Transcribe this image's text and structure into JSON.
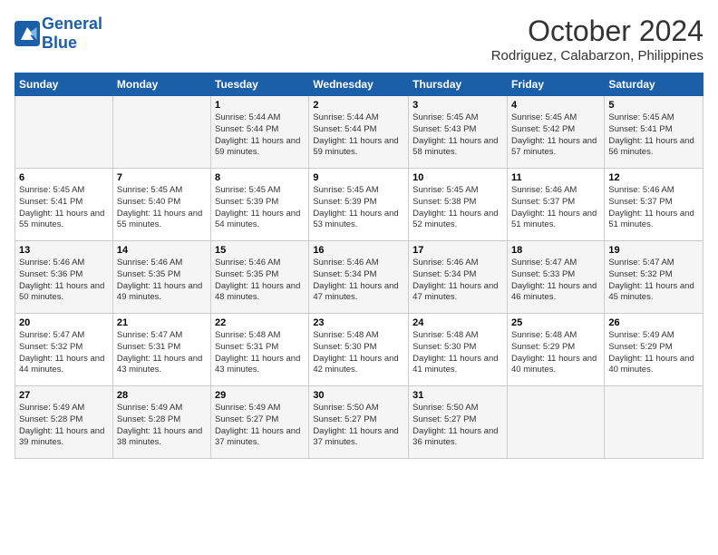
{
  "header": {
    "logo_line1": "General",
    "logo_line2": "Blue",
    "title": "October 2024",
    "subtitle": "Rodriguez, Calabarzon, Philippines"
  },
  "weekdays": [
    "Sunday",
    "Monday",
    "Tuesday",
    "Wednesday",
    "Thursday",
    "Friday",
    "Saturday"
  ],
  "weeks": [
    [
      {
        "day": "",
        "info": ""
      },
      {
        "day": "",
        "info": ""
      },
      {
        "day": "1",
        "info": "Sunrise: 5:44 AM\nSunset: 5:44 PM\nDaylight: 11 hours and 59 minutes."
      },
      {
        "day": "2",
        "info": "Sunrise: 5:44 AM\nSunset: 5:44 PM\nDaylight: 11 hours and 59 minutes."
      },
      {
        "day": "3",
        "info": "Sunrise: 5:45 AM\nSunset: 5:43 PM\nDaylight: 11 hours and 58 minutes."
      },
      {
        "day": "4",
        "info": "Sunrise: 5:45 AM\nSunset: 5:42 PM\nDaylight: 11 hours and 57 minutes."
      },
      {
        "day": "5",
        "info": "Sunrise: 5:45 AM\nSunset: 5:41 PM\nDaylight: 11 hours and 56 minutes."
      }
    ],
    [
      {
        "day": "6",
        "info": "Sunrise: 5:45 AM\nSunset: 5:41 PM\nDaylight: 11 hours and 55 minutes."
      },
      {
        "day": "7",
        "info": "Sunrise: 5:45 AM\nSunset: 5:40 PM\nDaylight: 11 hours and 55 minutes."
      },
      {
        "day": "8",
        "info": "Sunrise: 5:45 AM\nSunset: 5:39 PM\nDaylight: 11 hours and 54 minutes."
      },
      {
        "day": "9",
        "info": "Sunrise: 5:45 AM\nSunset: 5:39 PM\nDaylight: 11 hours and 53 minutes."
      },
      {
        "day": "10",
        "info": "Sunrise: 5:45 AM\nSunset: 5:38 PM\nDaylight: 11 hours and 52 minutes."
      },
      {
        "day": "11",
        "info": "Sunrise: 5:46 AM\nSunset: 5:37 PM\nDaylight: 11 hours and 51 minutes."
      },
      {
        "day": "12",
        "info": "Sunrise: 5:46 AM\nSunset: 5:37 PM\nDaylight: 11 hours and 51 minutes."
      }
    ],
    [
      {
        "day": "13",
        "info": "Sunrise: 5:46 AM\nSunset: 5:36 PM\nDaylight: 11 hours and 50 minutes."
      },
      {
        "day": "14",
        "info": "Sunrise: 5:46 AM\nSunset: 5:35 PM\nDaylight: 11 hours and 49 minutes."
      },
      {
        "day": "15",
        "info": "Sunrise: 5:46 AM\nSunset: 5:35 PM\nDaylight: 11 hours and 48 minutes."
      },
      {
        "day": "16",
        "info": "Sunrise: 5:46 AM\nSunset: 5:34 PM\nDaylight: 11 hours and 47 minutes."
      },
      {
        "day": "17",
        "info": "Sunrise: 5:46 AM\nSunset: 5:34 PM\nDaylight: 11 hours and 47 minutes."
      },
      {
        "day": "18",
        "info": "Sunrise: 5:47 AM\nSunset: 5:33 PM\nDaylight: 11 hours and 46 minutes."
      },
      {
        "day": "19",
        "info": "Sunrise: 5:47 AM\nSunset: 5:32 PM\nDaylight: 11 hours and 45 minutes."
      }
    ],
    [
      {
        "day": "20",
        "info": "Sunrise: 5:47 AM\nSunset: 5:32 PM\nDaylight: 11 hours and 44 minutes."
      },
      {
        "day": "21",
        "info": "Sunrise: 5:47 AM\nSunset: 5:31 PM\nDaylight: 11 hours and 43 minutes."
      },
      {
        "day": "22",
        "info": "Sunrise: 5:48 AM\nSunset: 5:31 PM\nDaylight: 11 hours and 43 minutes."
      },
      {
        "day": "23",
        "info": "Sunrise: 5:48 AM\nSunset: 5:30 PM\nDaylight: 11 hours and 42 minutes."
      },
      {
        "day": "24",
        "info": "Sunrise: 5:48 AM\nSunset: 5:30 PM\nDaylight: 11 hours and 41 minutes."
      },
      {
        "day": "25",
        "info": "Sunrise: 5:48 AM\nSunset: 5:29 PM\nDaylight: 11 hours and 40 minutes."
      },
      {
        "day": "26",
        "info": "Sunrise: 5:49 AM\nSunset: 5:29 PM\nDaylight: 11 hours and 40 minutes."
      }
    ],
    [
      {
        "day": "27",
        "info": "Sunrise: 5:49 AM\nSunset: 5:28 PM\nDaylight: 11 hours and 39 minutes."
      },
      {
        "day": "28",
        "info": "Sunrise: 5:49 AM\nSunset: 5:28 PM\nDaylight: 11 hours and 38 minutes."
      },
      {
        "day": "29",
        "info": "Sunrise: 5:49 AM\nSunset: 5:27 PM\nDaylight: 11 hours and 37 minutes."
      },
      {
        "day": "30",
        "info": "Sunrise: 5:50 AM\nSunset: 5:27 PM\nDaylight: 11 hours and 37 minutes."
      },
      {
        "day": "31",
        "info": "Sunrise: 5:50 AM\nSunset: 5:27 PM\nDaylight: 11 hours and 36 minutes."
      },
      {
        "day": "",
        "info": ""
      },
      {
        "day": "",
        "info": ""
      }
    ]
  ]
}
